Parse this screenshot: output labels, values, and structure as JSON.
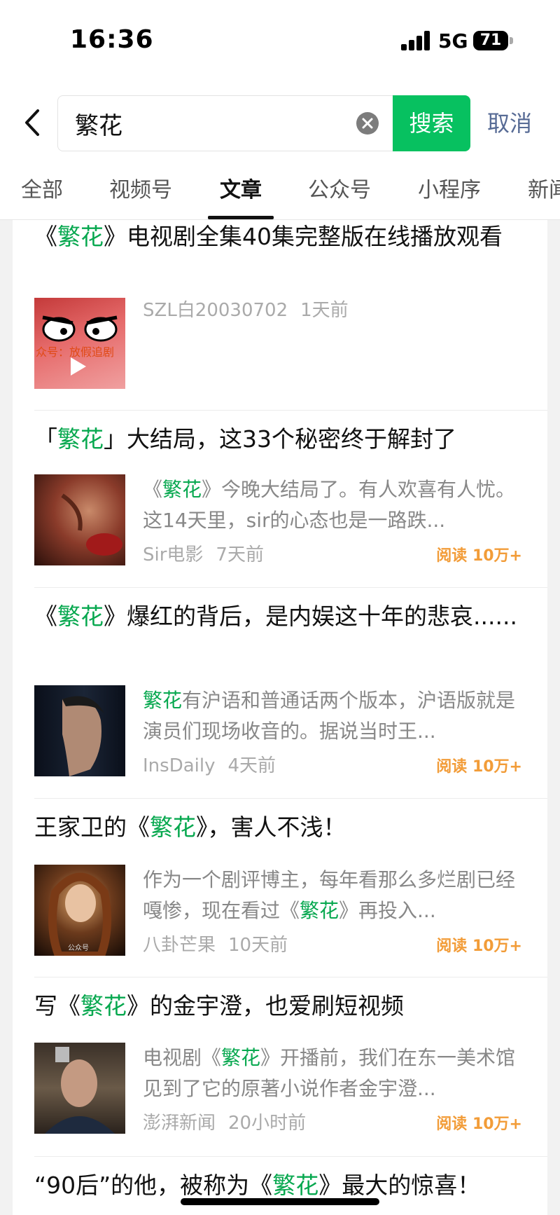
{
  "status_bar": {
    "time": "16:36",
    "network": "5G",
    "battery": "71"
  },
  "search": {
    "query": "繁花",
    "button_label": "搜索",
    "cancel_label": "取消"
  },
  "tabs": [
    {
      "label": "全部"
    },
    {
      "label": "视频号"
    },
    {
      "label": "文章",
      "active": true
    },
    {
      "label": "公众号"
    },
    {
      "label": "小程序"
    },
    {
      "label": "新闻"
    }
  ],
  "articles": [
    {
      "title": [
        "《",
        "繁花",
        "》电视剧全集40集完整版在线播放观看"
      ],
      "snippet": [],
      "author": "SZL白20030702",
      "time": "1天前",
      "read": "",
      "thumb_text": "众号：放假追剧",
      "video": true
    },
    {
      "title": [
        "「",
        "繁花",
        "」大结局，这33个秘密终于解封了"
      ],
      "snippet": [
        "《",
        "繁花",
        "》今晚大结局了。有人欢喜有人忧。这14天里，sir的心态也是一路跌..."
      ],
      "author": "Sir电影",
      "time": "7天前",
      "read": "阅读 10万+"
    },
    {
      "title": [
        "《",
        "繁花",
        "》爆红的背后，是内娱这十年的悲哀......"
      ],
      "snippet": [
        "",
        "繁花",
        "有沪语和普通话两个版本，沪语版就是演员们现场收音的。据说当时王..."
      ],
      "author": "InsDaily",
      "time": "4天前",
      "read": "阅读 10万+"
    },
    {
      "title": [
        "王家卫的《",
        "繁花",
        "》，害人不浅！"
      ],
      "snippet": [
        "作为一个剧评博主，每年看那么多烂剧已经嘎惨，现在看过《",
        "繁花",
        "》再投入..."
      ],
      "author": "八卦芒果",
      "time": "10天前",
      "read": "阅读 10万+",
      "thumb_text": "公众号"
    },
    {
      "title": [
        "写《",
        "繁花",
        "》的金宇澄，也爱刷短视频"
      ],
      "snippet": [
        "电视剧《",
        "繁花",
        "》开播前，我们在东一美术馆见到了它的原著小说作者金宇澄..."
      ],
      "author": "澎湃新闻",
      "time": "20小时前",
      "read": "阅读 10万+"
    },
    {
      "title": [
        "“90后”的他，被称为《",
        "繁花",
        "》最大的惊喜！"
      ],
      "snippet": [],
      "author": "",
      "time": "",
      "read": ""
    }
  ],
  "colors": {
    "accent_green": "#07c160",
    "highlight_green": "#07a84f",
    "read_orange": "#f29c38",
    "link_blue": "#576b95"
  }
}
